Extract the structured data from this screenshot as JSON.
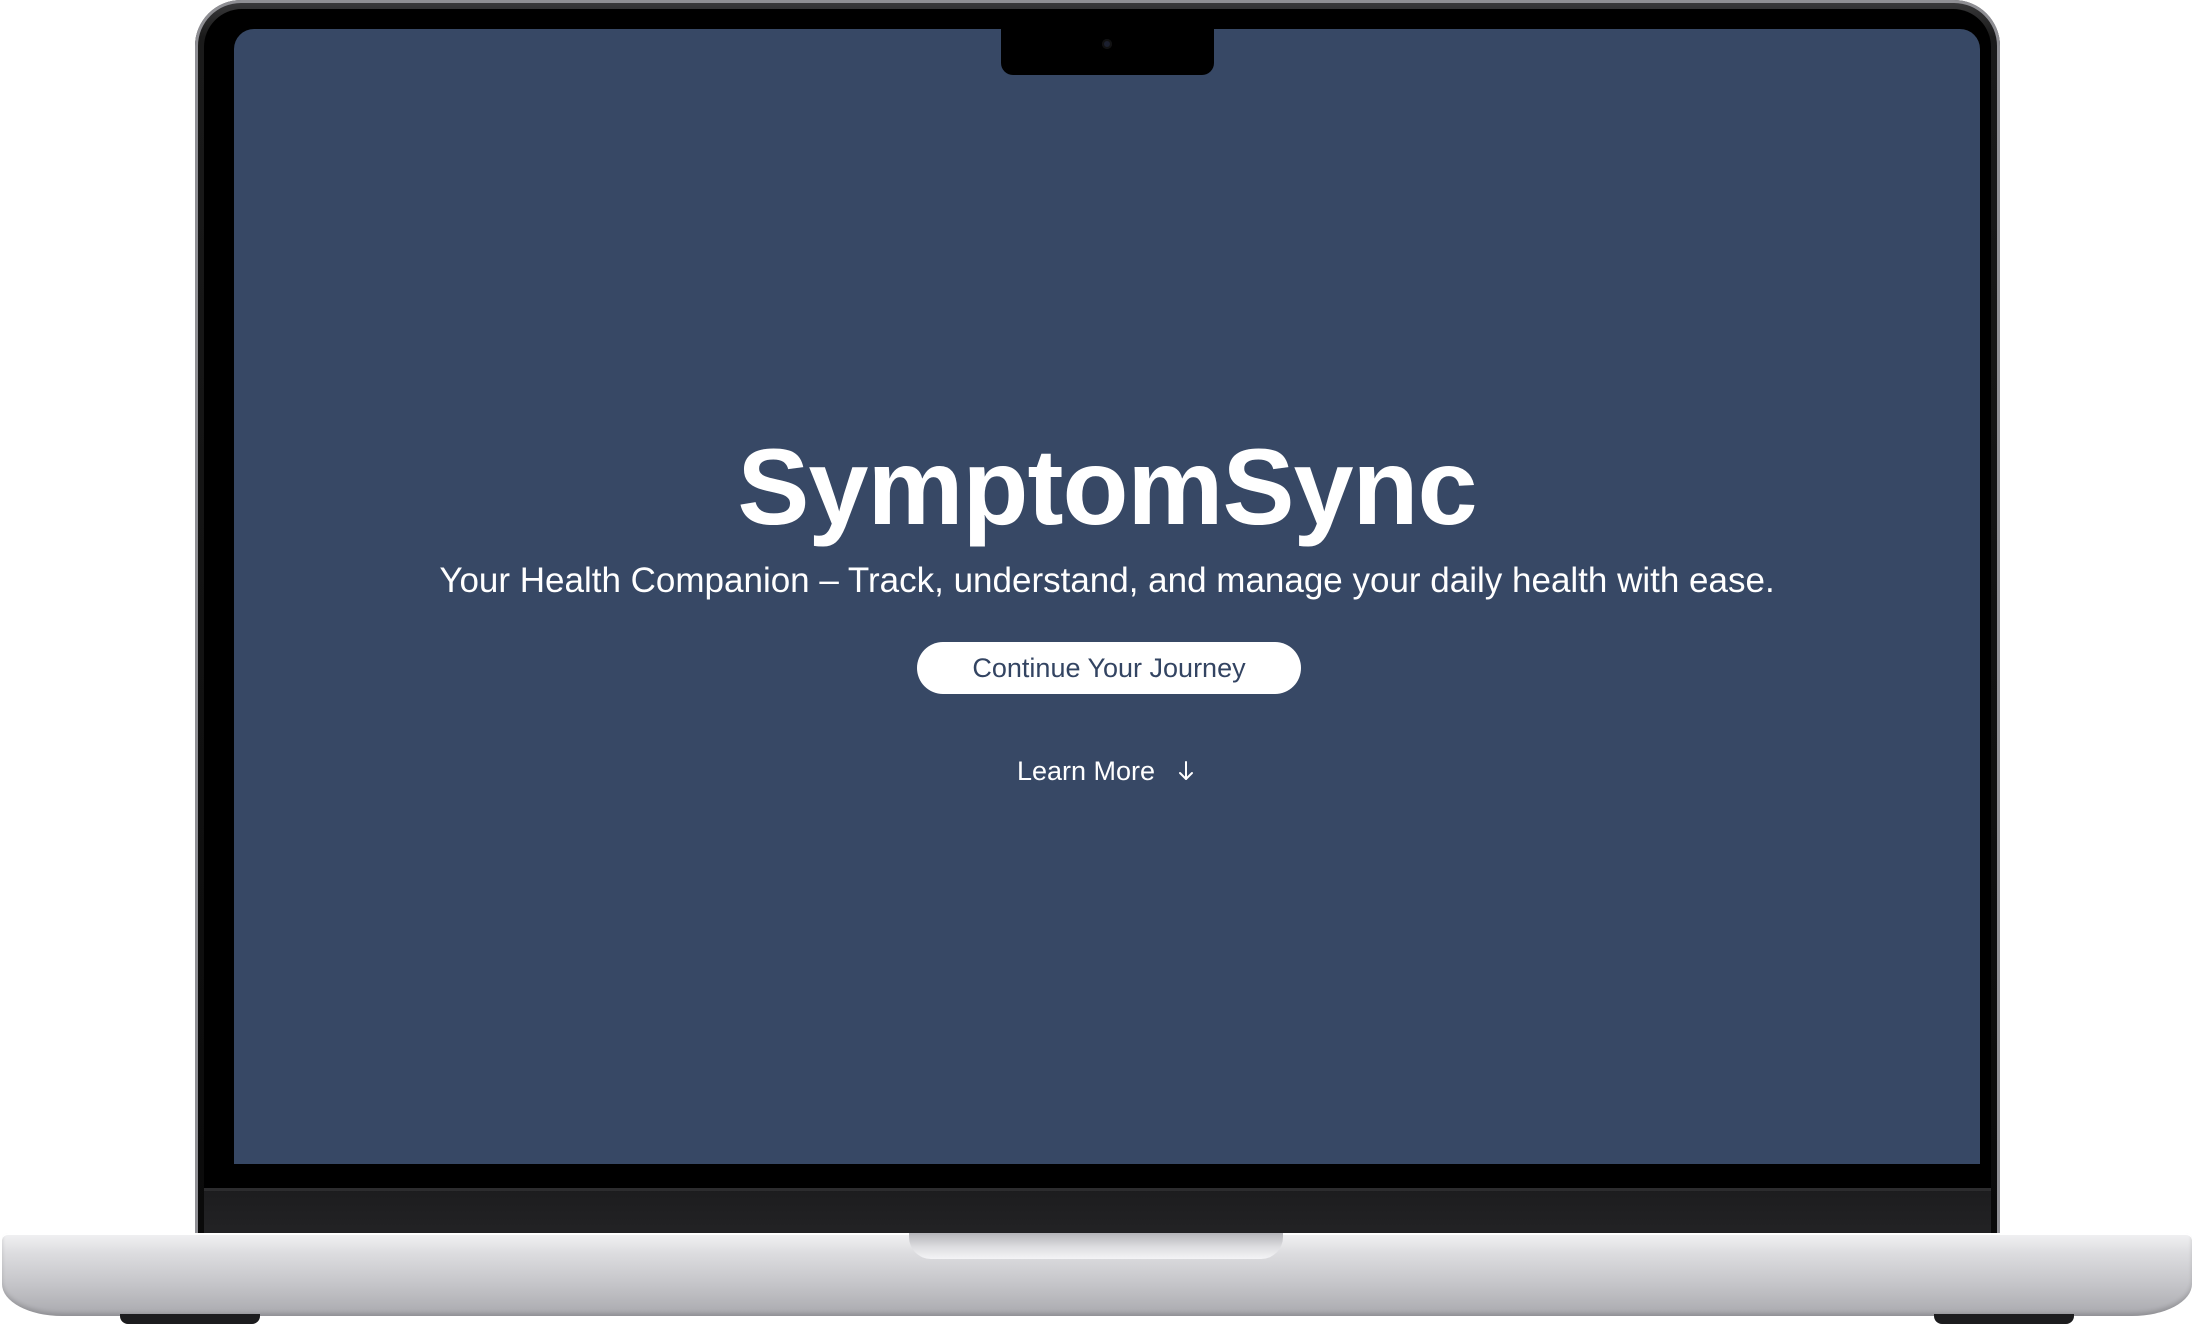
{
  "app": {
    "brand": "SymptomSync",
    "tagline": "Your Health Companion – Track, understand, and manage your daily health with ease.",
    "cta_label": "Continue Your Journey",
    "learn_more_label": "Learn More",
    "learn_more_icon": "arrow-down-icon"
  },
  "colors": {
    "screen_background": "#374865",
    "text": "#ffffff",
    "button_background": "#ffffff",
    "button_text": "#334462"
  },
  "device": {
    "frame": "laptop-mockup"
  }
}
